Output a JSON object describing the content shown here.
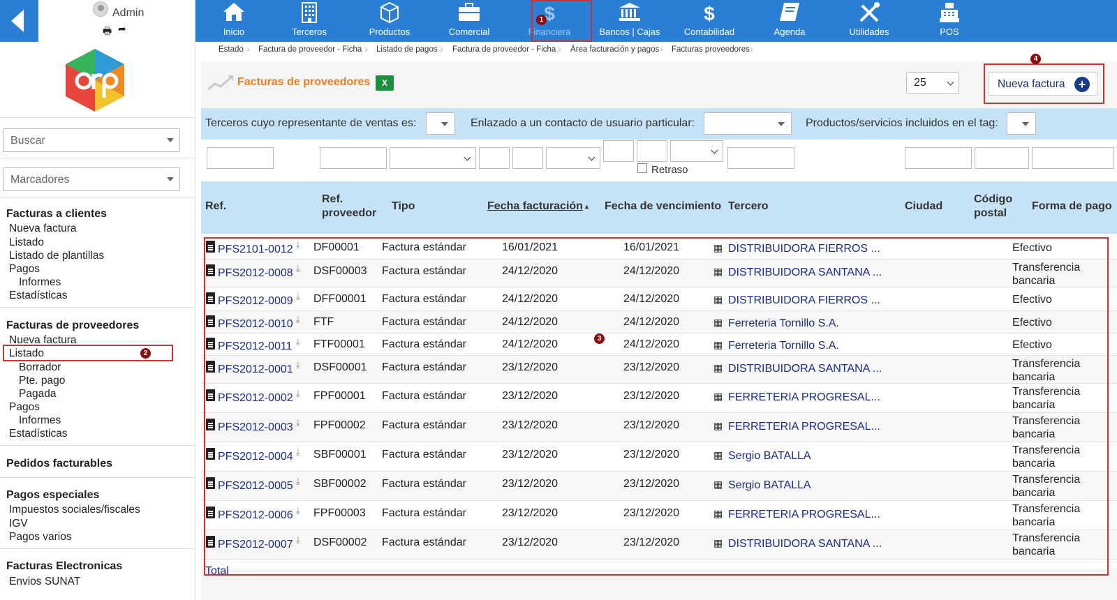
{
  "user": {
    "name": "Admin"
  },
  "sidebar": {
    "search_placeholder": "Buscar",
    "bookmarks_placeholder": "Marcadores",
    "sections": {
      "customer_invoices": {
        "title": "Facturas a clientes",
        "new": "Nueva factura",
        "list": "Listado",
        "templates": "Listado de plantillas",
        "payments": "Pagos",
        "reports": "Informes",
        "stats": "Estadísticas"
      },
      "supplier_invoices": {
        "title": "Facturas de proveedores",
        "new": "Nueva factura",
        "list": "Listado",
        "draft": "Borrador",
        "pending": "Pte. pago",
        "paid": "Pagada",
        "payments": "Pagos",
        "reports": "Informes",
        "stats": "Estadísticas"
      },
      "billable_orders": {
        "title": "Pedidos facturables"
      },
      "special_payments": {
        "title": "Pagos especiales",
        "social_taxes": "Impuestos sociales/fiscales",
        "igv": "IGV",
        "various": "Pagos varios"
      },
      "e_invoices": {
        "title": "Facturas Electronicas",
        "sunat": "Envios SUNAT"
      }
    }
  },
  "topnav": [
    {
      "label": "Inicio",
      "icon": "home-icon"
    },
    {
      "label": "Terceros",
      "icon": "building-icon"
    },
    {
      "label": "Productos",
      "icon": "box-icon"
    },
    {
      "label": "Comercial",
      "icon": "briefcase-icon"
    },
    {
      "label": "Financiera",
      "icon": "dollar-icon"
    },
    {
      "label": "Bancos | Cajas",
      "icon": "bank-icon"
    },
    {
      "label": "Contabilidad",
      "icon": "dollar-icon"
    },
    {
      "label": "Agenda",
      "icon": "book-icon"
    },
    {
      "label": "Utilidades",
      "icon": "tools-icon"
    },
    {
      "label": "POS",
      "icon": "register-icon"
    }
  ],
  "breadcrumb": [
    "Estado",
    "Factura de proveedor - Ficha",
    "Listado de pagos",
    "Factura de proveedor - Ficha",
    "Área facturación y pagos",
    "Facturas proveedores"
  ],
  "page": {
    "title": "Facturas de proveedores",
    "xls_label": "X",
    "per_page": "25",
    "new_invoice_label": "Nueva factura",
    "new_invoice_plus": "+"
  },
  "filters": {
    "sales_rep_label": "Terceros cuyo representante de ventas es:",
    "user_contact_label": "Enlazado a un contacto de usuario particular:",
    "tag_label": "Productos/servicios incluidos en el tag:",
    "late_label": "Retraso"
  },
  "table": {
    "headers": {
      "ref": "Ref.",
      "supplier_ref_1": "Ref.",
      "supplier_ref_2": "proveedor",
      "type": "Tipo",
      "invoice_date": "Fecha facturación",
      "sort_arrow": "▲",
      "due_date": "Fecha de vencimiento",
      "third": "Tercero",
      "city": "Ciudad",
      "zip_1": "Código",
      "zip_2": "postal",
      "payment": "Forma de pago"
    },
    "rows": [
      {
        "ref": "PFS2101-0012",
        "sref": "DF00001",
        "type": "Factura estándar",
        "date": "16/01/2021",
        "due": "16/01/2021",
        "third": "DISTRIBUIDORA FIERROS ...",
        "pay1": "Efectivo",
        "pay2": ""
      },
      {
        "ref": "PFS2012-0008",
        "sref": "DSF00003",
        "type": "Factura estándar",
        "date": "24/12/2020",
        "due": "24/12/2020",
        "third": "DISTRIBUIDORA SANTANA ...",
        "pay1": "Transferencia",
        "pay2": "bancaria"
      },
      {
        "ref": "PFS2012-0009",
        "sref": "DFF00001",
        "type": "Factura estándar",
        "date": "24/12/2020",
        "due": "24/12/2020",
        "third": "DISTRIBUIDORA FIERROS ...",
        "pay1": "Efectivo",
        "pay2": ""
      },
      {
        "ref": "PFS2012-0010",
        "sref": "FTF",
        "type": "Factura estándar",
        "date": "24/12/2020",
        "due": "24/12/2020",
        "third": "Ferreteria Tornillo S.A.",
        "pay1": "Efectivo",
        "pay2": ""
      },
      {
        "ref": "PFS2012-0011",
        "sref": "FTF00001",
        "type": "Factura estándar",
        "date": "24/12/2020",
        "due": "24/12/2020",
        "third": "Ferreteria Tornillo S.A.",
        "pay1": "Efectivo",
        "pay2": ""
      },
      {
        "ref": "PFS2012-0001",
        "sref": "DSF00001",
        "type": "Factura estándar",
        "date": "23/12/2020",
        "due": "23/12/2020",
        "third": "DISTRIBUIDORA SANTANA ...",
        "pay1": "Transferencia",
        "pay2": "bancaria"
      },
      {
        "ref": "PFS2012-0002",
        "sref": "FPF00001",
        "type": "Factura estándar",
        "date": "23/12/2020",
        "due": "23/12/2020",
        "third": "FERRETERIA PROGRESAL...",
        "pay1": "Transferencia",
        "pay2": "bancaria"
      },
      {
        "ref": "PFS2012-0003",
        "sref": "FPF00002",
        "type": "Factura estándar",
        "date": "23/12/2020",
        "due": "23/12/2020",
        "third": "FERRETERIA PROGRESAL...",
        "pay1": "Transferencia",
        "pay2": "bancaria"
      },
      {
        "ref": "PFS2012-0004",
        "sref": "SBF00001",
        "type": "Factura estándar",
        "date": "23/12/2020",
        "due": "23/12/2020",
        "third": "Sergio BATALLA",
        "pay1": "Transferencia",
        "pay2": "bancaria"
      },
      {
        "ref": "PFS2012-0005",
        "sref": "SBF00002",
        "type": "Factura estándar",
        "date": "23/12/2020",
        "due": "23/12/2020",
        "third": "Sergio BATALLA",
        "pay1": "Transferencia",
        "pay2": "bancaria"
      },
      {
        "ref": "PFS2012-0006",
        "sref": "FPF00003",
        "type": "Factura estándar",
        "date": "23/12/2020",
        "due": "23/12/2020",
        "third": "FERRETERIA PROGRESAL...",
        "pay1": "Transferencia",
        "pay2": "bancaria"
      },
      {
        "ref": "PFS2012-0007",
        "sref": "DSF00002",
        "type": "Factura estándar",
        "date": "23/12/2020",
        "due": "23/12/2020",
        "third": "DISTRIBUIDORA SANTANA ...",
        "pay1": "Transferencia",
        "pay2": "bancaria"
      }
    ],
    "total_label": "Total"
  },
  "markers": [
    "1",
    "2",
    "3",
    "4"
  ],
  "colors": {
    "nav_blue": "#2a7fd4",
    "title_orange": "#e67e22",
    "header_blue": "#c6e2f7",
    "link": "#1a2b8a",
    "marker": "#8b0d0d",
    "highlight": "#d03030"
  }
}
